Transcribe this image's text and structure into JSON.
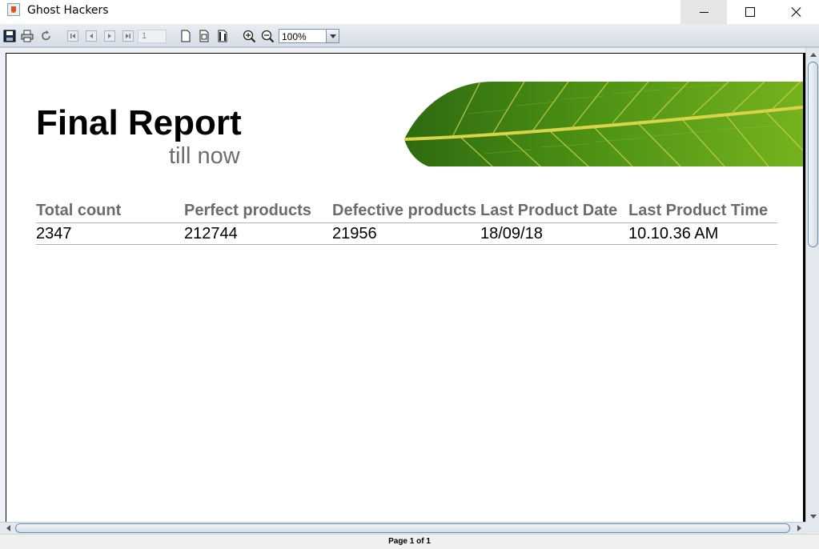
{
  "window": {
    "title": "Ghost Hackers"
  },
  "toolbar": {
    "page_number": "1",
    "zoom": "100%",
    "icons": [
      "save-icon",
      "print-icon",
      "reload-icon",
      "first-page-icon",
      "previous-page-icon",
      "next-page-icon",
      "last-page-icon",
      "actual-size-icon",
      "fit-page-icon",
      "fit-width-icon",
      "zoom-in-icon",
      "zoom-out-icon"
    ]
  },
  "report": {
    "title": "Final Report",
    "subtitle": "till now",
    "table": {
      "headers": [
        "Total count",
        "Perfect products",
        "Defective products",
        "Last Product Date",
        "Last Product Time"
      ],
      "rows": [
        [
          "2347",
          "212744",
          "21956",
          "18/09/18",
          "10.10.36 AM"
        ]
      ]
    }
  },
  "status": {
    "page_indicator": "Page 1 of 1"
  },
  "colors": {
    "header_text": "#6b6b6b",
    "subtitle_text": "#6d6d6d",
    "leaf_green": "#5a9a1a"
  }
}
